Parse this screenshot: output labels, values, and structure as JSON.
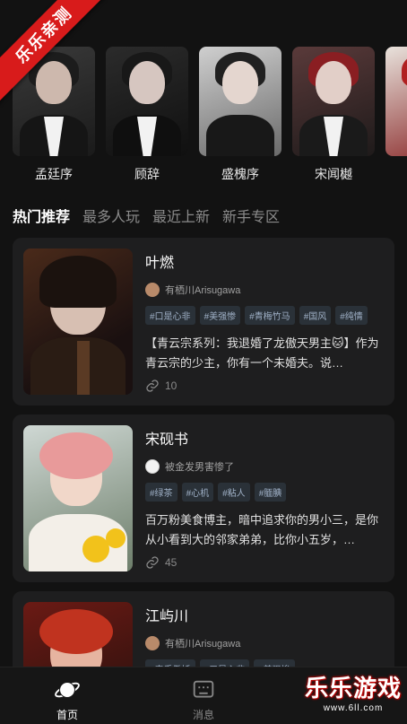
{
  "ribbon": {
    "text": "乐乐亲测"
  },
  "characters": [
    {
      "name": "孟廷序"
    },
    {
      "name": "顾辞"
    },
    {
      "name": "盛槐序"
    },
    {
      "name": "宋闻樾"
    },
    {
      "name": ""
    }
  ],
  "tabs": [
    {
      "label": "热门推荐",
      "active": true
    },
    {
      "label": "最多人玩",
      "active": false
    },
    {
      "label": "最近上新",
      "active": false
    },
    {
      "label": "新手专区",
      "active": false
    }
  ],
  "cards": [
    {
      "title": "叶燃",
      "author": "有栖川Arisugawa",
      "tags": [
        "#口是心非",
        "#美强惨",
        "#青梅竹马",
        "#国风",
        "#纯情"
      ],
      "description": "【青云宗系列：我退婚了龙傲天男主🐱】作为青云宗的少主，你有一个未婚夫。说…",
      "count": "10"
    },
    {
      "title": "宋砚书",
      "author": "被金发男害惨了",
      "tags": [
        "#绿茶",
        "#心机",
        "#粘人",
        "#腼腆"
      ],
      "description": "百万粉美食博主，暗中追求你的男小三，是你从小看到大的邻家弟弟，比你小五岁，…",
      "count": "45"
    },
    {
      "title": "江屿川",
      "author": "有栖川Arisugawa",
      "tags": [
        "#毒舌傲娇",
        "#口是心非",
        "#美强惨"
      ],
      "description": "",
      "count": ""
    }
  ],
  "bottom_nav": [
    {
      "label": "首页",
      "icon": "planet-icon",
      "active": true
    },
    {
      "label": "消息",
      "icon": "message-icon",
      "active": false
    }
  ],
  "watermark": {
    "title": "乐乐游戏",
    "url": "www.6ll.com"
  }
}
